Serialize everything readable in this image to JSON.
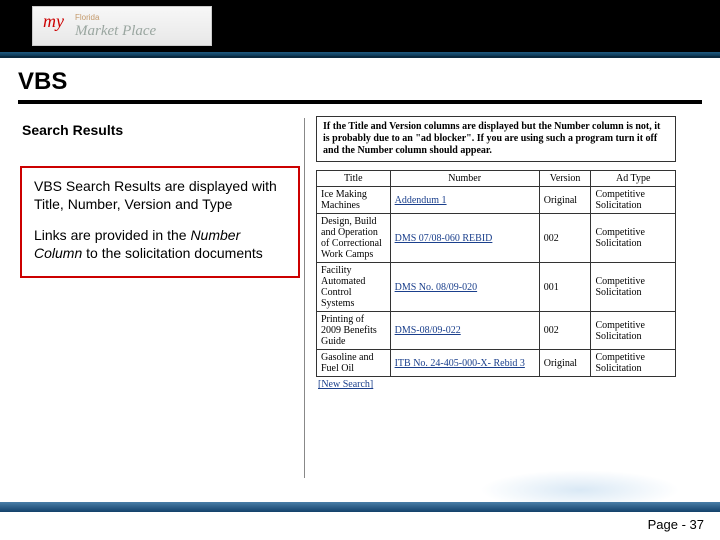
{
  "logo": {
    "my": "my",
    "florida": "Florida",
    "marketplace": "Market Place"
  },
  "title": "VBS",
  "subheading": "Search Results",
  "callout": {
    "p1_a": "VBS Search Results are displayed with Title, Number, Version and Type",
    "p2_a": "Links are provided in the ",
    "p2_em": "Number Column",
    "p2_b": " to the solicitation documents"
  },
  "info_text": "If the Title and Version columns are displayed but the Number column is not, it is probably due to an \"ad blocker\". If you are using such a program turn it off and the Number column should appear.",
  "headers": {
    "title": "Title",
    "number": "Number",
    "version": "Version",
    "adtype": "Ad Type"
  },
  "rows": [
    {
      "title": "Ice Making Machines",
      "number": "Addendum 1",
      "version": "",
      "adtype": "Competitive Solicitation",
      "ver_prefix": "Original"
    },
    {
      "title": "Design, Build and Operation of Correctional Work Camps",
      "number": "DMS 07/08-060 REBID",
      "version": "002",
      "adtype": "Competitive Solicitation"
    },
    {
      "title": "Facility Automated Control Systems",
      "number": "DMS No. 08/09-020",
      "version": "001",
      "adtype": "Competitive Solicitation"
    },
    {
      "title": "Printing of 2009 Benefits Guide",
      "number": "DMS-08/09-022",
      "version": "002",
      "adtype": "Competitive Solicitation"
    },
    {
      "title": "Gasoline and Fuel Oil",
      "number": "ITB No. 24-405-000-X- Rebid 3",
      "version": "",
      "adtype": "Competitive Solicitation",
      "ver_prefix": "Original"
    }
  ],
  "chart_data": {
    "type": "table",
    "title": "VBS Search Results",
    "columns": [
      "Title",
      "Number",
      "Version",
      "Ad Type"
    ],
    "rows": [
      [
        "Ice Making Machines",
        "Addendum 1",
        "Original",
        "Competitive Solicitation"
      ],
      [
        "Design, Build and Operation of Correctional Work Camps",
        "DMS 07/08-060 REBID",
        "002",
        "Competitive Solicitation"
      ],
      [
        "Facility Automated Control Systems",
        "DMS No. 08/09-020",
        "001",
        "Competitive Solicitation"
      ],
      [
        "Printing of 2009 Benefits Guide",
        "DMS-08/09-022",
        "002",
        "Competitive Solicitation"
      ],
      [
        "Gasoline and Fuel Oil",
        "ITB No. 24-405-000-X- Rebid 3",
        "Original",
        "Competitive Solicitation"
      ]
    ]
  },
  "new_search": "[New Search]",
  "page_label": "Page - 37"
}
